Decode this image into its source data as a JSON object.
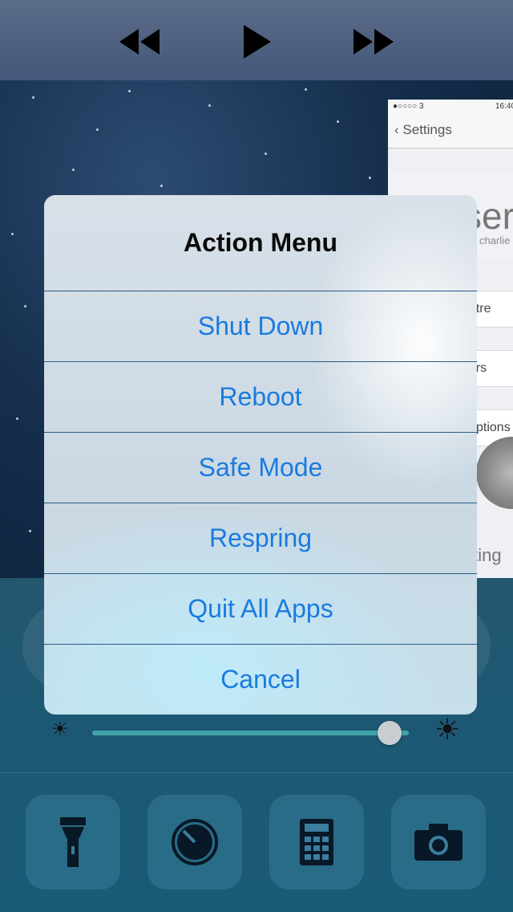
{
  "media_controls": {
    "previous_icon": "rewind-icon",
    "play_icon": "play-icon",
    "next_icon": "fast-forward-icon"
  },
  "background_app": {
    "status_text": "●○○○○ 3",
    "time_text": "16:40",
    "back_label": "Settings",
    "title_fragment": "ser",
    "subtitle_fragment": "charlie",
    "rows": [
      "entre",
      "ners",
      "ptions"
    ],
    "app_label_fragment": "tting"
  },
  "alert": {
    "title": "Action Menu",
    "buttons": [
      "Shut Down",
      "Reboot",
      "Safe Mode",
      "Respring",
      "Quit All Apps",
      "Cancel"
    ]
  },
  "control_center": {
    "brightness_level": 0.94,
    "tools": [
      "flashlight-icon",
      "timer-icon",
      "calculator-icon",
      "camera-icon"
    ]
  },
  "colors": {
    "alert_button_text": "#1a7be0",
    "separator": "#2b5b86"
  }
}
